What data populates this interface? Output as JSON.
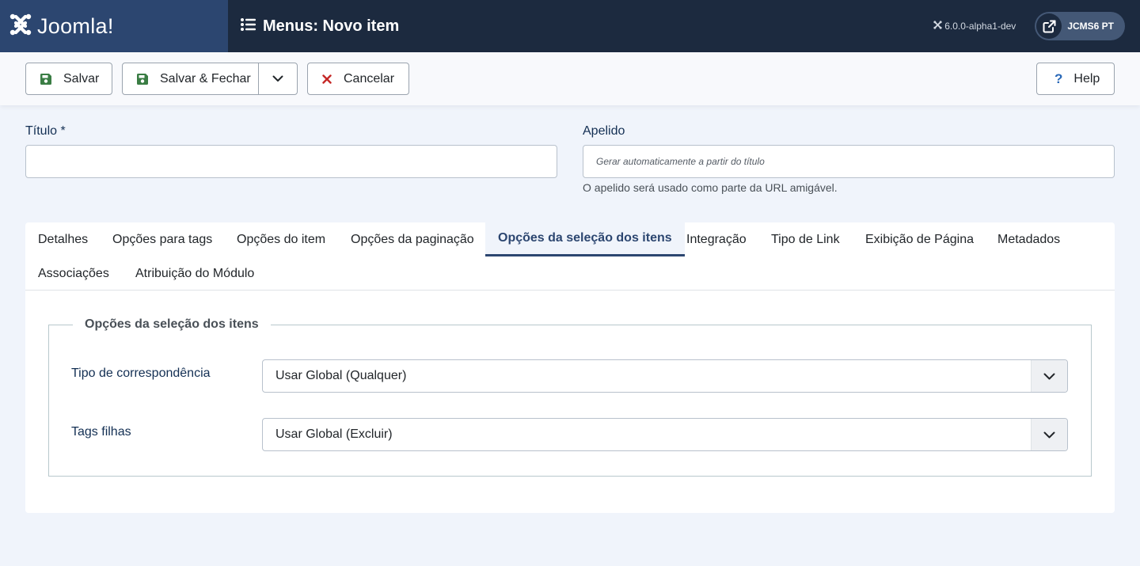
{
  "header": {
    "logo_text": "Joomla!",
    "page_title": "Menus: Novo item",
    "version": "6.0.0-alpha1-dev",
    "site_button": "JCMS6 PT"
  },
  "toolbar": {
    "save": "Salvar",
    "save_close": "Salvar & Fechar",
    "cancel": "Cancelar",
    "help": "Help"
  },
  "form": {
    "title_label": "Título *",
    "title_value": "",
    "alias_label": "Apelido",
    "alias_placeholder": "Gerar automaticamente a partir do título",
    "alias_hint": "O apelido será usado como parte da URL amigável."
  },
  "tabs": [
    {
      "label": "Detalhes",
      "active": false
    },
    {
      "label": "Opções para tags",
      "active": false
    },
    {
      "label": "Opções do item",
      "active": false
    },
    {
      "label": "Opções da paginação",
      "active": false
    },
    {
      "label": "Opções da seleção dos itens",
      "active": true
    },
    {
      "label": "Integração",
      "active": false
    },
    {
      "label": "Tipo de Link",
      "active": false
    },
    {
      "label": "Exibição de Página",
      "active": false
    },
    {
      "label": "Metadados",
      "active": false
    },
    {
      "label": "Associações",
      "active": false
    },
    {
      "label": "Atribuição do Módulo",
      "active": false
    }
  ],
  "panel": {
    "legend": "Opções da seleção dos itens",
    "fields": [
      {
        "label": "Tipo de correspondência",
        "value": "Usar Global (Qualquer)"
      },
      {
        "label": "Tags filhas",
        "value": "Usar Global (Excluir)"
      }
    ]
  },
  "colors": {
    "header_bg": "#1c2a3f",
    "logo_bg": "#2c4670",
    "accent": "#2c4670",
    "save_icon": "#3a7d44",
    "cancel_icon": "#c52827"
  }
}
